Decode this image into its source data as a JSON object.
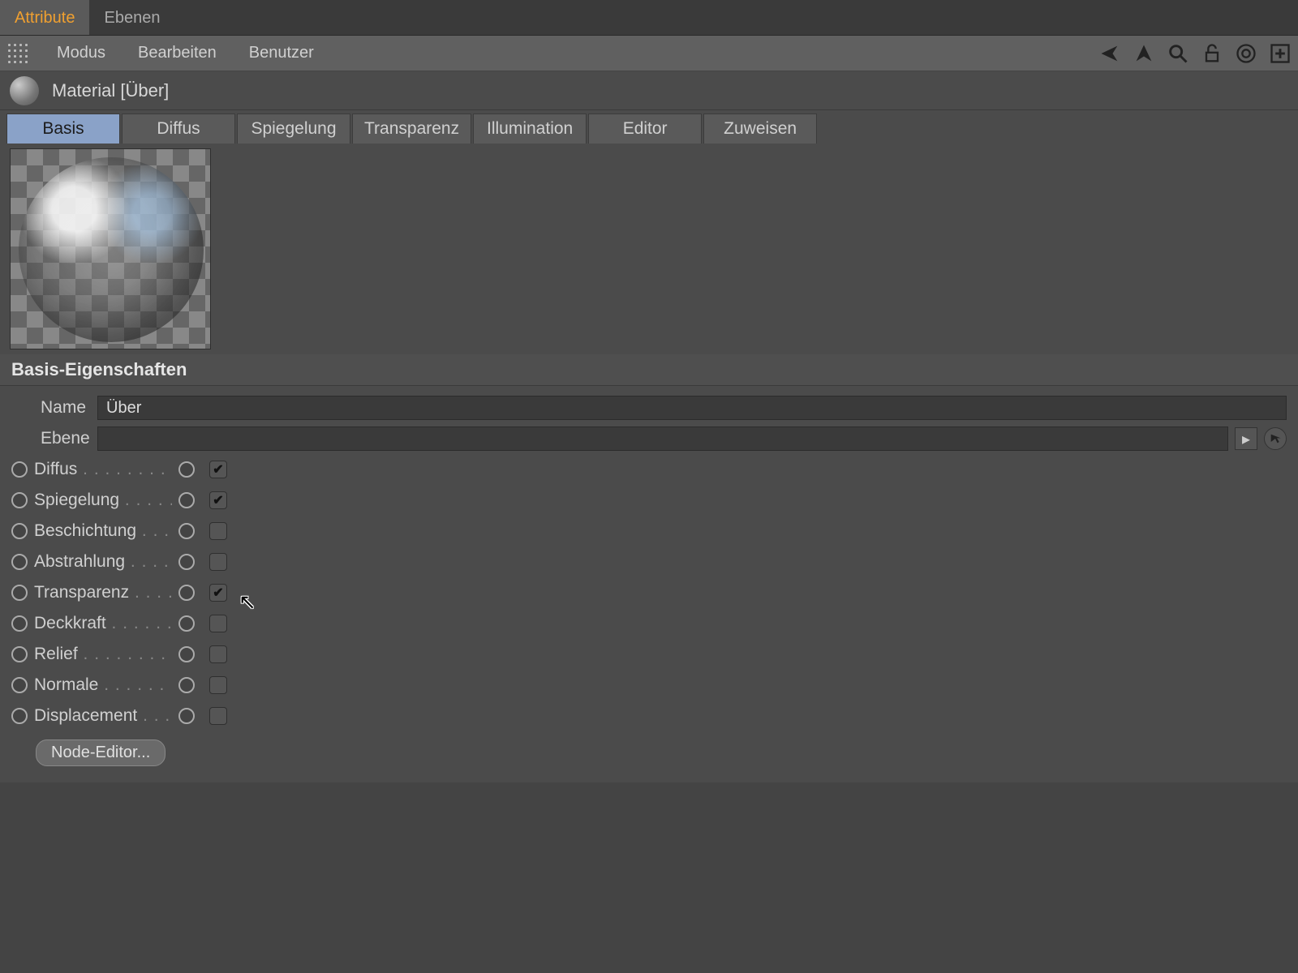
{
  "top_tabs": {
    "attribute": "Attribute",
    "ebenen": "Ebenen",
    "active": "attribute"
  },
  "menu": {
    "modus": "Modus",
    "bearbeiten": "Bearbeiten",
    "benutzer": "Benutzer"
  },
  "identity": {
    "title": "Material [Über]"
  },
  "channel_tabs": {
    "basis": "Basis",
    "diffus": "Diffus",
    "spiegelung": "Spiegelung",
    "transparenz": "Transparenz",
    "illumination": "Illumination",
    "editor": "Editor",
    "zuweisen": "Zuweisen",
    "active": "basis"
  },
  "section_title": "Basis-Eigenschaften",
  "name_field": {
    "label": "Name",
    "value": "Über"
  },
  "ebene_field": {
    "label": "Ebene",
    "value": ""
  },
  "channels": [
    {
      "key": "diffus",
      "label": "Diffus",
      "checked": true
    },
    {
      "key": "spiegelung",
      "label": "Spiegelung",
      "checked": true
    },
    {
      "key": "beschichtung",
      "label": "Beschichtung",
      "checked": false
    },
    {
      "key": "abstrahlung",
      "label": "Abstrahlung",
      "checked": false
    },
    {
      "key": "transparenz",
      "label": "Transparenz",
      "checked": true
    },
    {
      "key": "deckkraft",
      "label": "Deckkraft",
      "checked": false
    },
    {
      "key": "relief",
      "label": "Relief",
      "checked": false
    },
    {
      "key": "normale",
      "label": "Normale",
      "checked": false
    },
    {
      "key": "displacement",
      "label": "Displacement",
      "checked": false
    }
  ],
  "node_editor_label": "Node-Editor...",
  "icons": {
    "back": "nav-back-icon",
    "up": "nav-up-icon",
    "search": "search-icon",
    "lock": "lock-icon",
    "target": "target-icon",
    "add": "add-panel-icon"
  }
}
